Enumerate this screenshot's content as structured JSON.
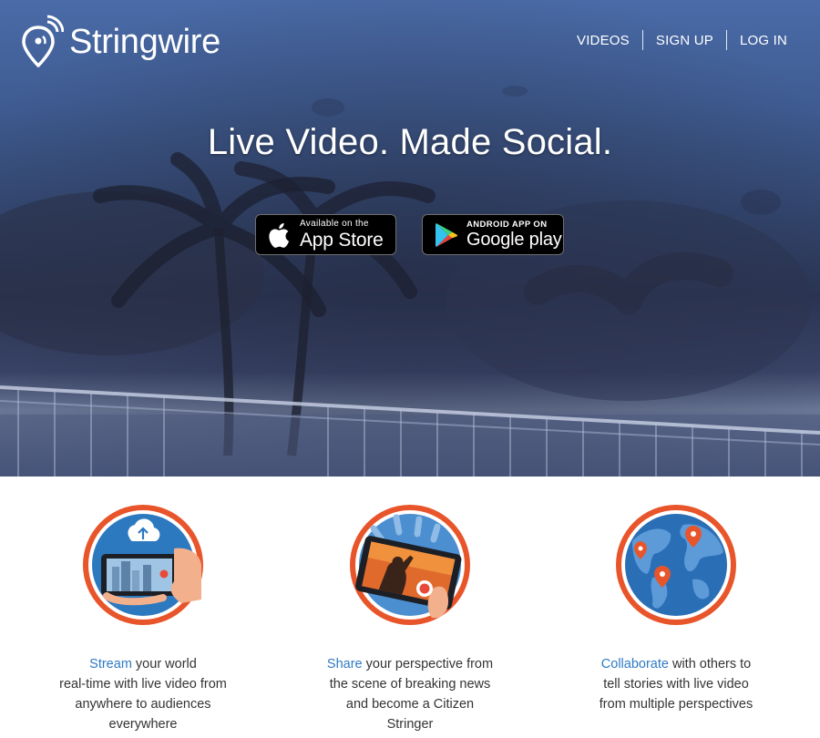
{
  "brand": {
    "name": "Stringwire"
  },
  "nav": {
    "videos": "VIDEOS",
    "signup": "SIGN UP",
    "login": "LOG IN"
  },
  "hero": {
    "headline": "Live Video. Made Social."
  },
  "stores": {
    "apple": {
      "small": "Available on the",
      "big": "App Store"
    },
    "google": {
      "small": "ANDROID APP ON",
      "big": "Google play"
    }
  },
  "features": [
    {
      "highlight": "Stream",
      "lines": [
        " your world",
        "real-time with live video from",
        "anywhere to audiences",
        "everywhere"
      ]
    },
    {
      "highlight": "Share",
      "lines": [
        " your perspective from",
        "the scene of breaking news",
        "and become a Citizen",
        "Stringer"
      ]
    },
    {
      "highlight": "Collaborate",
      "lines": [
        " with others to",
        "tell stories with live video",
        "from multiple perspectives"
      ]
    }
  ],
  "colors": {
    "accent": "#2f7ac4",
    "ring": "#e8552a",
    "hero": "#3f5c92"
  },
  "icons": [
    "location-signal-icon",
    "apple-icon",
    "google-play-icon",
    "cloud-upload-icon",
    "phone-camera-icon",
    "globe-icon"
  ]
}
